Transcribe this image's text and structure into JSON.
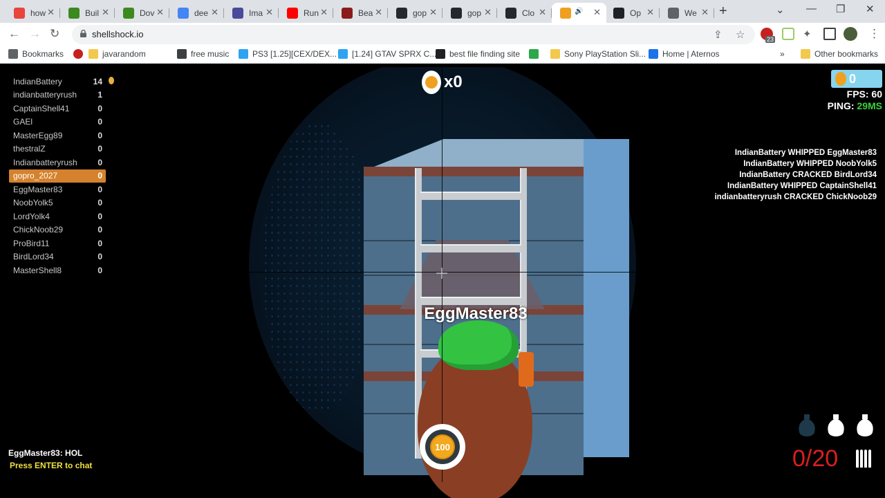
{
  "browser": {
    "tabs": [
      {
        "title": "how",
        "icon": "multicolor-icon",
        "color": "#e8453c"
      },
      {
        "title": "Buil",
        "icon": "minecraft-icon",
        "color": "#3c8a1e"
      },
      {
        "title": "Dov",
        "icon": "minecraft-icon",
        "color": "#3c8a1e"
      },
      {
        "title": "dee",
        "icon": "google-icon",
        "color": "#4285f4"
      },
      {
        "title": "Ima",
        "icon": "chart-icon",
        "color": "#4a4a9a"
      },
      {
        "title": "Run",
        "icon": "youtube-icon",
        "color": "#ff0000"
      },
      {
        "title": "Bea",
        "icon": "m-icon",
        "color": "#8b1a1a"
      },
      {
        "title": "gop",
        "icon": "github-icon",
        "color": "#24292e"
      },
      {
        "title": "gop",
        "icon": "github-icon",
        "color": "#24292e"
      },
      {
        "title": "Clo",
        "icon": "github-icon",
        "color": "#24292e"
      },
      {
        "title": "",
        "icon": "shellshock-icon",
        "color": "#f0a020"
      },
      {
        "title": "Op",
        "icon": "openai-icon",
        "color": "#202124"
      },
      {
        "title": "We",
        "icon": "globe-icon",
        "color": "#5f6368"
      }
    ],
    "url": "shellshock.io",
    "extension_badge": "23",
    "bookmarks": [
      {
        "label": "Bookmarks"
      },
      {
        "label": ""
      },
      {
        "label": "javarandom"
      },
      {
        "label": "free music"
      },
      {
        "label": "PS3 [1.25][CEX/DEX..."
      },
      {
        "label": "[1.24] GTAV SPRX C..."
      },
      {
        "label": "best file finding site"
      },
      {
        "label": ""
      },
      {
        "label": "Sony PlayStation Sli..."
      },
      {
        "label": "Home | Aternos"
      },
      {
        "label": "Other bookmarks"
      }
    ],
    "more_chevron": "»"
  },
  "game": {
    "scoreboard": [
      {
        "name": "IndianBattery",
        "score": "14"
      },
      {
        "name": "indianbatteryrush",
        "score": "1"
      },
      {
        "name": "CaptainShell41",
        "score": "0"
      },
      {
        "name": "GAEl",
        "score": "0"
      },
      {
        "name": "MasterEgg89",
        "score": "0"
      },
      {
        "name": "thestralZ",
        "score": "0"
      },
      {
        "name": "Indianbatteryrush",
        "score": "0"
      },
      {
        "name": "gopro_2027",
        "score": "0",
        "self": true
      },
      {
        "name": "EggMaster83",
        "score": "0"
      },
      {
        "name": "NoobYolk5",
        "score": "0"
      },
      {
        "name": "LordYolk4",
        "score": "0"
      },
      {
        "name": "ChickNoob29",
        "score": "0"
      },
      {
        "name": "ProBird11",
        "score": "0"
      },
      {
        "name": "BirdLord34",
        "score": "0"
      },
      {
        "name": "MasterShell8",
        "score": "0"
      }
    ],
    "kill_streak": "x0",
    "eggs": "0",
    "fps_label": "FPS: 60",
    "ping_label": "PING:",
    "ping_value": "29MS",
    "kill_feed": [
      "IndianBattery WHIPPED EggMaster83",
      "IndianBattery WHIPPED NoobYolk5",
      "IndianBattery CRACKED BirdLord34",
      "IndianBattery WHIPPED CaptainShell41",
      "indianbatteryrush CRACKED ChickNoob29"
    ],
    "target_name": "EggMaster83",
    "health": "100",
    "chat_message": "EggMaster83: HOL",
    "chat_prompt": "Press ENTER to chat",
    "ammo": "0/20",
    "grenades_available": 2,
    "grenades_total": 3,
    "colors": {
      "self_row": "#d4822e",
      "ping_good": "#3ccf3c",
      "ammo_empty": "#d8201e",
      "chat_prompt": "#f0e040"
    }
  }
}
